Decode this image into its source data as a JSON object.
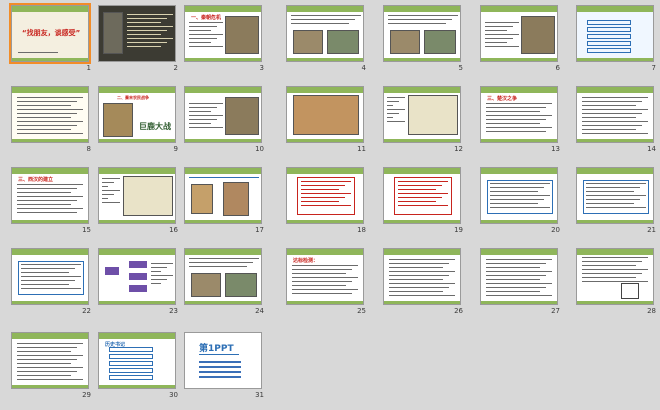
{
  "app": {
    "view": "slide-sorter"
  },
  "slides": [
    {
      "number": "1",
      "title": "“找朋友，谈感受”",
      "caption": "",
      "selected": true
    },
    {
      "number": "2",
      "title": "",
      "caption": "",
      "selected": false
    },
    {
      "number": "3",
      "title": "一、秦朝危机",
      "caption": "",
      "selected": false
    },
    {
      "number": "4",
      "title": "",
      "caption": "",
      "selected": false
    },
    {
      "number": "5",
      "title": "",
      "caption": "",
      "selected": false
    },
    {
      "number": "6",
      "title": "",
      "caption": "",
      "selected": false
    },
    {
      "number": "7",
      "title": "",
      "caption": "",
      "selected": false
    },
    {
      "number": "8",
      "title": "",
      "caption": "",
      "selected": false
    },
    {
      "number": "9",
      "title": "二、秦末农民战争",
      "caption": "巨鹿大战",
      "selected": false
    },
    {
      "number": "10",
      "title": "",
      "caption": "",
      "selected": false
    },
    {
      "number": "11",
      "title": "",
      "caption": "",
      "selected": false
    },
    {
      "number": "12",
      "title": "",
      "caption": "",
      "selected": false
    },
    {
      "number": "13",
      "title": "三、楚汉之争",
      "caption": "",
      "selected": false
    },
    {
      "number": "14",
      "title": "",
      "caption": "",
      "selected": false
    },
    {
      "number": "15",
      "title": "三、西汉的建立",
      "caption": "",
      "selected": false
    },
    {
      "number": "16",
      "title": "",
      "caption": "",
      "selected": false
    },
    {
      "number": "17",
      "title": "",
      "caption": "",
      "selected": false
    },
    {
      "number": "18",
      "title": "",
      "caption": "",
      "selected": false
    },
    {
      "number": "19",
      "title": "",
      "caption": "",
      "selected": false
    },
    {
      "number": "20",
      "title": "",
      "caption": "",
      "selected": false
    },
    {
      "number": "21",
      "title": "",
      "caption": "",
      "selected": false
    },
    {
      "number": "22",
      "title": "",
      "caption": "",
      "selected": false
    },
    {
      "number": "23",
      "title": "",
      "caption": "",
      "selected": false
    },
    {
      "number": "24",
      "title": "",
      "caption": "",
      "selected": false
    },
    {
      "number": "25",
      "title": "达标检测：",
      "caption": "",
      "selected": false
    },
    {
      "number": "26",
      "title": "",
      "caption": "",
      "selected": false
    },
    {
      "number": "27",
      "title": "",
      "caption": "",
      "selected": false
    },
    {
      "number": "28",
      "title": "",
      "caption": "",
      "selected": false
    },
    {
      "number": "29",
      "title": "",
      "caption": "",
      "selected": false
    },
    {
      "number": "30",
      "title": "历史书记",
      "caption": "",
      "selected": false
    },
    {
      "number": "31",
      "title": "第1PPT",
      "caption": "",
      "selected": false
    }
  ],
  "colors": {
    "background": "#d8d8d8",
    "selection": "#f28c28",
    "accent_red": "#c8241e",
    "accent_blue": "#2d6fb5"
  }
}
